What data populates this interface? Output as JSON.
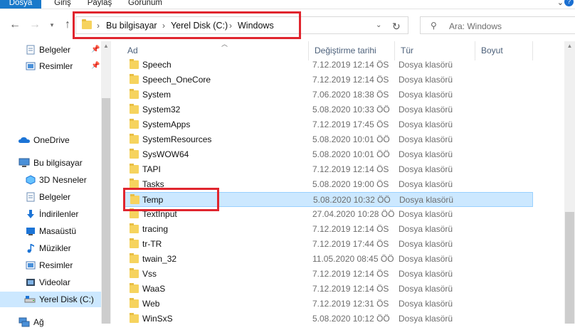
{
  "ribbon": {
    "tabs": [
      "Dosya",
      "Giriş",
      "Paylaş",
      "Görünüm"
    ]
  },
  "address": {
    "crumbs": [
      "Bu bilgisayar",
      "Yerel Disk (C:)",
      "Windows"
    ]
  },
  "search": {
    "placeholder": "Ara: Windows"
  },
  "columns": {
    "name": "Ad",
    "date": "Değiştirme tarihi",
    "type": "Tür",
    "size": "Boyut"
  },
  "nav": {
    "quick": [
      {
        "label": "Belgeler",
        "icon": "documents-icon"
      },
      {
        "label": "Resimler",
        "icon": "pictures-icon"
      }
    ],
    "onedrive": "OneDrive",
    "this_pc": "Bu bilgisayar",
    "pc_items": [
      {
        "label": "3D Nesneler",
        "icon": "3d-objects-icon"
      },
      {
        "label": "Belgeler",
        "icon": "documents-icon"
      },
      {
        "label": "İndirilenler",
        "icon": "downloads-icon"
      },
      {
        "label": "Masaüstü",
        "icon": "desktop-icon"
      },
      {
        "label": "Müzikler",
        "icon": "music-icon"
      },
      {
        "label": "Resimler",
        "icon": "pictures-icon"
      },
      {
        "label": "Videolar",
        "icon": "videos-icon"
      },
      {
        "label": "Yerel Disk (C:)",
        "icon": "drive-icon"
      }
    ],
    "network": "Ağ"
  },
  "files": [
    {
      "name": "Speech",
      "date": "7.12.2019 12:14 ÖS",
      "type": "Dosya klasörü"
    },
    {
      "name": "Speech_OneCore",
      "date": "7.12.2019 12:14 ÖS",
      "type": "Dosya klasörü"
    },
    {
      "name": "System",
      "date": "7.06.2020 18:38 ÖS",
      "type": "Dosya klasörü"
    },
    {
      "name": "System32",
      "date": "5.08.2020 10:33 ÖÖ",
      "type": "Dosya klasörü"
    },
    {
      "name": "SystemApps",
      "date": "7.12.2019 17:45 ÖS",
      "type": "Dosya klasörü"
    },
    {
      "name": "SystemResources",
      "date": "5.08.2020 10:01 ÖÖ",
      "type": "Dosya klasörü"
    },
    {
      "name": "SysWOW64",
      "date": "5.08.2020 10:01 ÖÖ",
      "type": "Dosya klasörü"
    },
    {
      "name": "TAPI",
      "date": "7.12.2019 12:14 ÖS",
      "type": "Dosya klasörü"
    },
    {
      "name": "Tasks",
      "date": "5.08.2020 19:00 ÖS",
      "type": "Dosya klasörü"
    },
    {
      "name": "Temp",
      "date": "5.08.2020 10:32 ÖÖ",
      "type": "Dosya klasörü",
      "selected": true
    },
    {
      "name": "TextInput",
      "date": "27.04.2020 10:28 ÖÖ",
      "type": "Dosya klasörü"
    },
    {
      "name": "tracing",
      "date": "7.12.2019 12:14 ÖS",
      "type": "Dosya klasörü"
    },
    {
      "name": "tr-TR",
      "date": "7.12.2019 17:44 ÖS",
      "type": "Dosya klasörü"
    },
    {
      "name": "twain_32",
      "date": "11.05.2020 08:45 ÖÖ",
      "type": "Dosya klasörü"
    },
    {
      "name": "Vss",
      "date": "7.12.2019 12:14 ÖS",
      "type": "Dosya klasörü"
    },
    {
      "name": "WaaS",
      "date": "7.12.2019 12:14 ÖS",
      "type": "Dosya klasörü"
    },
    {
      "name": "Web",
      "date": "7.12.2019 12:31 ÖS",
      "type": "Dosya klasörü"
    },
    {
      "name": "WinSxS",
      "date": "5.08.2020 10:12 ÖÖ",
      "type": "Dosya klasörü"
    }
  ],
  "colors": {
    "selection": "#cce8ff",
    "highlight": "#e0252e",
    "ribbon_file": "#1979ca"
  }
}
